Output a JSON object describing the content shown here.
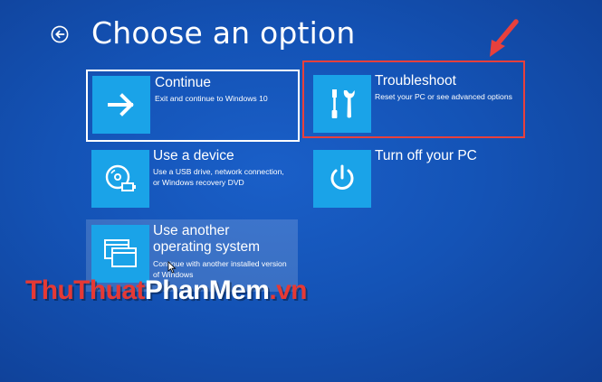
{
  "header": {
    "title": "Choose an option"
  },
  "options": {
    "continue": {
      "title": "Continue",
      "description": "Exit and continue to Windows 10"
    },
    "troubleshoot": {
      "title": "Troubleshoot",
      "description": "Reset your PC or see advanced options"
    },
    "use_device": {
      "title": "Use a device",
      "description_line1": "Use a USB drive, network connection,",
      "description_line2": "or Windows recovery DVD"
    },
    "turn_off": {
      "title": "Turn off your PC"
    },
    "another_os": {
      "title_line1": "Use another",
      "title_line2": "operating system",
      "description_line1": "Continue with another installed version",
      "description_line2": "of Windows"
    }
  },
  "watermark": {
    "part1": "ThuThuat",
    "part2": "PhanMem",
    "part3": ".vn"
  },
  "icons": {
    "back": "back-arrow-icon",
    "continue": "right-arrow-icon",
    "troubleshoot": "tools-icon",
    "use_device": "disc-usb-icon",
    "turn_off": "power-icon",
    "another_os": "windows-stack-icon"
  },
  "colors": {
    "background": "#1453b6",
    "tile_icon": "#1aa3e8",
    "highlight": "#e8403c",
    "watermark_red": "#e53935"
  }
}
